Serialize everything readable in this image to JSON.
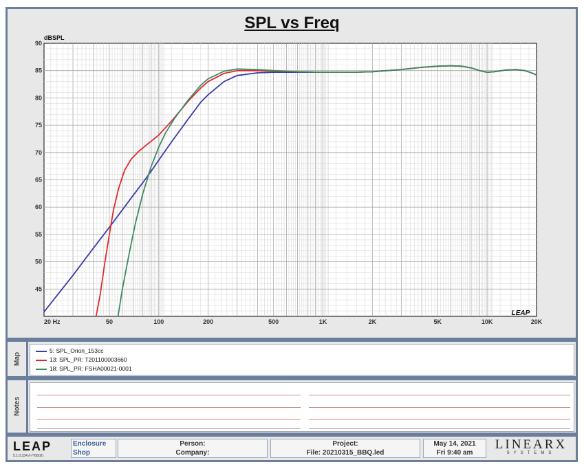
{
  "chart_data": {
    "type": "line",
    "title": "SPL vs Freq",
    "ylabel": "dBSPL",
    "xlabel": "",
    "xscale": "log",
    "xlim": [
      20,
      20000
    ],
    "ylim": [
      40,
      90
    ],
    "grid": true,
    "x_ticks": [
      {
        "value": 20,
        "label": "20 Hz"
      },
      {
        "value": 50,
        "label": "50"
      },
      {
        "value": 100,
        "label": "100"
      },
      {
        "value": 200,
        "label": "200"
      },
      {
        "value": 500,
        "label": "500"
      },
      {
        "value": 1000,
        "label": "1K"
      },
      {
        "value": 2000,
        "label": "2K"
      },
      {
        "value": 5000,
        "label": "5K"
      },
      {
        "value": 10000,
        "label": "10K"
      },
      {
        "value": 20000,
        "label": "20K"
      }
    ],
    "y_ticks": [
      90,
      85,
      80,
      75,
      70,
      65,
      60,
      55,
      50,
      45
    ],
    "watermark": "LEAP",
    "series": [
      {
        "name": "5: SPL_Orion_153cc",
        "color": "#3a3aa8",
        "points": [
          [
            20,
            40.8
          ],
          [
            30,
            47.5
          ],
          [
            40,
            52.5
          ],
          [
            50,
            56.3
          ],
          [
            60,
            59.5
          ],
          [
            70,
            62.2
          ],
          [
            80,
            64.5
          ],
          [
            90,
            66.6
          ],
          [
            100,
            68.6
          ],
          [
            120,
            72
          ],
          [
            150,
            76
          ],
          [
            180,
            79.2
          ],
          [
            200,
            80.6
          ],
          [
            250,
            83
          ],
          [
            300,
            84.1
          ],
          [
            400,
            84.6
          ],
          [
            500,
            84.7
          ],
          [
            700,
            84.7
          ],
          [
            1000,
            84.7
          ],
          [
            1500,
            84.7
          ],
          [
            2000,
            84.8
          ],
          [
            3000,
            85.2
          ],
          [
            4000,
            85.6
          ],
          [
            5000,
            85.8
          ],
          [
            6000,
            85.9
          ],
          [
            7000,
            85.8
          ],
          [
            8000,
            85.5
          ],
          [
            9000,
            85
          ],
          [
            10000,
            84.7
          ],
          [
            11000,
            84.8
          ],
          [
            13000,
            85.1
          ],
          [
            15000,
            85.2
          ],
          [
            17000,
            85
          ],
          [
            19000,
            84.5
          ],
          [
            20000,
            84.2
          ]
        ]
      },
      {
        "name": "13: SPL_PR: T201100003660",
        "color": "#e02a2a",
        "points": [
          [
            41.5,
            40
          ],
          [
            44,
            44
          ],
          [
            47,
            50
          ],
          [
            50,
            55
          ],
          [
            53,
            59.5
          ],
          [
            57,
            63.5
          ],
          [
            62,
            66.8
          ],
          [
            68,
            68.8
          ],
          [
            76,
            70.3
          ],
          [
            85,
            71.5
          ],
          [
            100,
            73.2
          ],
          [
            120,
            75.8
          ],
          [
            150,
            79.3
          ],
          [
            180,
            81.8
          ],
          [
            200,
            83
          ],
          [
            250,
            84.5
          ],
          [
            300,
            85
          ],
          [
            400,
            85
          ],
          [
            500,
            84.9
          ],
          [
            700,
            84.8
          ],
          [
            1000,
            84.7
          ],
          [
            1500,
            84.7
          ],
          [
            2000,
            84.8
          ],
          [
            3000,
            85.2
          ],
          [
            4000,
            85.6
          ],
          [
            5000,
            85.8
          ],
          [
            6000,
            85.9
          ],
          [
            7000,
            85.8
          ],
          [
            8000,
            85.5
          ],
          [
            9000,
            85
          ],
          [
            10000,
            84.7
          ],
          [
            11000,
            84.8
          ],
          [
            13000,
            85.1
          ],
          [
            15000,
            85.2
          ],
          [
            17000,
            85
          ],
          [
            19000,
            84.5
          ],
          [
            20000,
            84.2
          ]
        ]
      },
      {
        "name": "18: SPL_PR: FSHA00021-0001",
        "color": "#3f8a62",
        "points": [
          [
            56.5,
            40
          ],
          [
            60,
            45
          ],
          [
            66,
            51.5
          ],
          [
            72,
            57
          ],
          [
            80,
            62.5
          ],
          [
            90,
            67.5
          ],
          [
            100,
            71
          ],
          [
            110,
            73.6
          ],
          [
            125,
            76.3
          ],
          [
            150,
            79.5
          ],
          [
            180,
            82.3
          ],
          [
            200,
            83.5
          ],
          [
            250,
            84.9
          ],
          [
            300,
            85.3
          ],
          [
            400,
            85.2
          ],
          [
            500,
            85
          ],
          [
            700,
            84.8
          ],
          [
            1000,
            84.7
          ],
          [
            1500,
            84.7
          ],
          [
            2000,
            84.8
          ],
          [
            3000,
            85.2
          ],
          [
            4000,
            85.6
          ],
          [
            5000,
            85.8
          ],
          [
            6000,
            85.9
          ],
          [
            7000,
            85.8
          ],
          [
            8000,
            85.5
          ],
          [
            9000,
            85
          ],
          [
            10000,
            84.7
          ],
          [
            11000,
            84.8
          ],
          [
            13000,
            85.1
          ],
          [
            15000,
            85.2
          ],
          [
            17000,
            85
          ],
          [
            19000,
            84.5
          ],
          [
            20000,
            84.2
          ]
        ]
      }
    ]
  },
  "sections": {
    "map_label": "Map",
    "notes_label": "Notes"
  },
  "footer": {
    "logo": "LEAP",
    "version": "5.1.0.334 //-/*/06/20",
    "product": "Enclosure",
    "product2": "Shop",
    "person_label": "Person:",
    "company_label": "Company:",
    "project_label": "Project:",
    "file_label": "File: 20210315_BBQ.led",
    "date": "May 14, 2021",
    "time": "Fri  9:40 am",
    "brand": "LINEARX",
    "brand_sub": "SYSTEMS"
  }
}
